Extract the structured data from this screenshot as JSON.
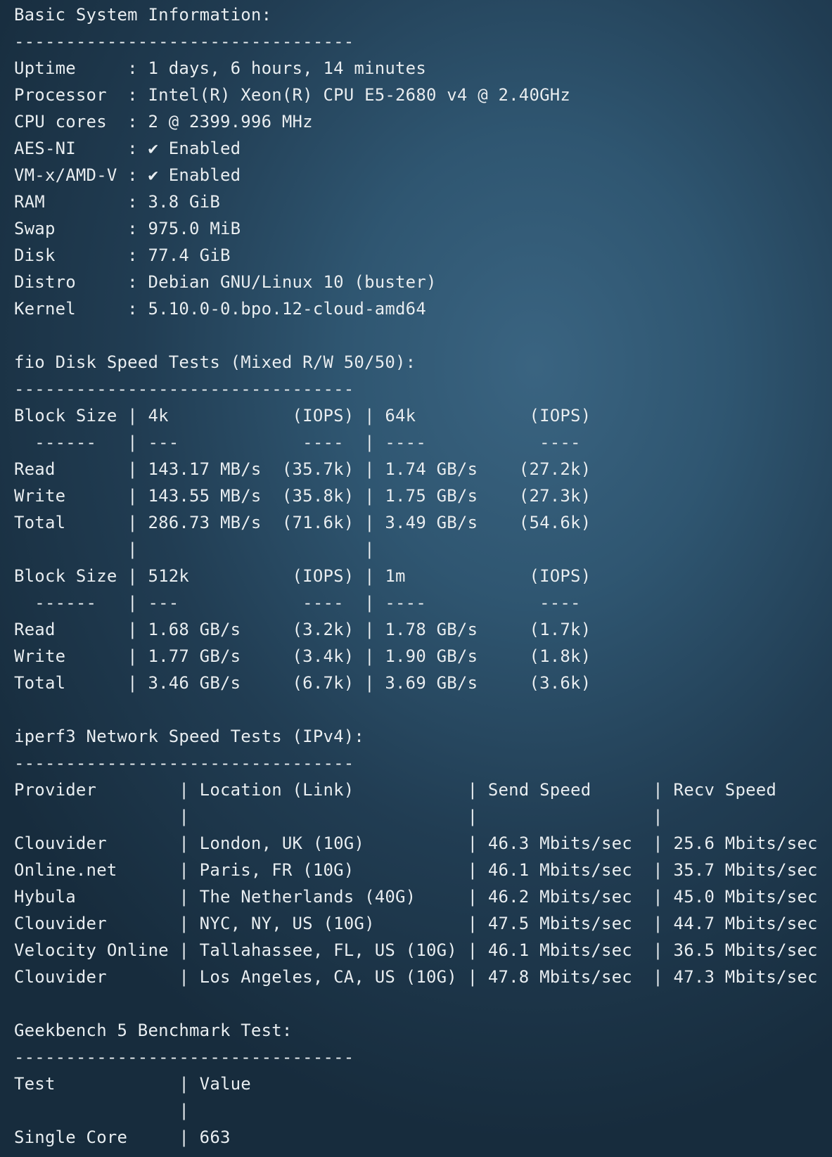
{
  "terminal": {
    "lines": [
      "Basic System Information:",
      "---------------------------------",
      "Uptime     : 1 days, 6 hours, 14 minutes",
      "Processor  : Intel(R) Xeon(R) CPU E5-2680 v4 @ 2.40GHz",
      "CPU cores  : 2 @ 2399.996 MHz",
      "AES-NI     : ✔ Enabled",
      "VM-x/AMD-V : ✔ Enabled",
      "RAM        : 3.8 GiB",
      "Swap       : 975.0 MiB",
      "Disk       : 77.4 GiB",
      "Distro     : Debian GNU/Linux 10 (buster)",
      "Kernel     : 5.10.0-0.bpo.12-cloud-amd64",
      "",
      "fio Disk Speed Tests (Mixed R/W 50/50):",
      "---------------------------------",
      "Block Size | 4k            (IOPS) | 64k           (IOPS)",
      "  ------   | ---            ----  | ----           ----",
      "Read       | 143.17 MB/s  (35.7k) | 1.74 GB/s    (27.2k)",
      "Write      | 143.55 MB/s  (35.8k) | 1.75 GB/s    (27.3k)",
      "Total      | 286.73 MB/s  (71.6k) | 3.49 GB/s    (54.6k)",
      "           |                      |",
      "Block Size | 512k          (IOPS) | 1m            (IOPS)",
      "  ------   | ---            ----  | ----           ----",
      "Read       | 1.68 GB/s     (3.2k) | 1.78 GB/s     (1.7k)",
      "Write      | 1.77 GB/s     (3.4k) | 1.90 GB/s     (1.8k)",
      "Total      | 3.46 GB/s     (6.7k) | 3.69 GB/s     (3.6k)",
      "",
      "iperf3 Network Speed Tests (IPv4):",
      "---------------------------------",
      "Provider        | Location (Link)           | Send Speed      | Recv Speed",
      "                |                           |                 |",
      "Clouvider       | London, UK (10G)          | 46.3 Mbits/sec  | 25.6 Mbits/sec",
      "Online.net      | Paris, FR (10G)           | 46.1 Mbits/sec  | 35.7 Mbits/sec",
      "Hybula          | The Netherlands (40G)     | 46.2 Mbits/sec  | 45.0 Mbits/sec",
      "Clouvider       | NYC, NY, US (10G)         | 47.5 Mbits/sec  | 44.7 Mbits/sec",
      "Velocity Online | Tallahassee, FL, US (10G) | 46.1 Mbits/sec  | 36.5 Mbits/sec",
      "Clouvider       | Los Angeles, CA, US (10G) | 47.8 Mbits/sec  | 47.3 Mbits/sec",
      "",
      "Geekbench 5 Benchmark Test:",
      "---------------------------------",
      "Test            | Value",
      "                |",
      "Single Core     | 663"
    ]
  }
}
